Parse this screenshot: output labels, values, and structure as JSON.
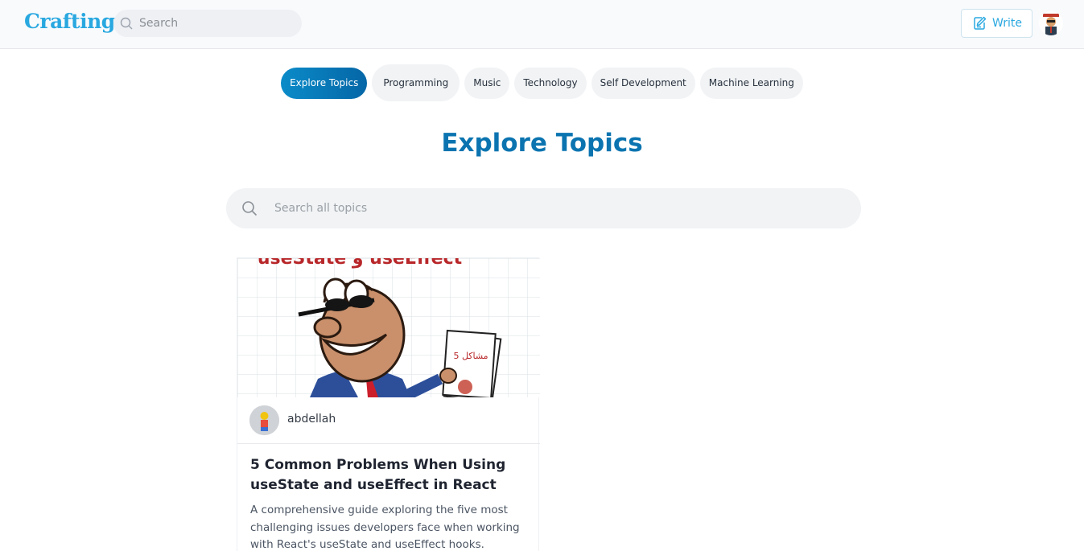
{
  "header": {
    "logo": "Crafting",
    "search_placeholder": "Search",
    "write_label": "Write",
    "icons": {
      "search": "search-icon",
      "write": "edit-pencil-icon",
      "avatar": "user-avatar"
    }
  },
  "tabs": [
    {
      "label": "Explore Topics",
      "active": true
    },
    {
      "label": "Programming",
      "active": false
    },
    {
      "label": "Music",
      "active": false
    },
    {
      "label": "Technology",
      "active": false
    },
    {
      "label": "Self Development",
      "active": false
    },
    {
      "label": "Machine Learning",
      "active": false
    }
  ],
  "page": {
    "title": "Explore Topics",
    "search_placeholder": "Search all topics"
  },
  "articles": [
    {
      "image_banner": "useState و useEffect",
      "image_paper_text": "5 مشاكل",
      "author": "abdellah",
      "title": "5 Common Problems When Using useState and useEffect in React",
      "description": "A comprehensive guide exploring the five most challenging issues developers face when working with React's useState and useEffect hooks."
    }
  ],
  "colors": {
    "brand": "#29a8e0",
    "title": "#0b74b0",
    "active_tab_start": "#0b8bc9",
    "active_tab_end": "#0566a6"
  }
}
